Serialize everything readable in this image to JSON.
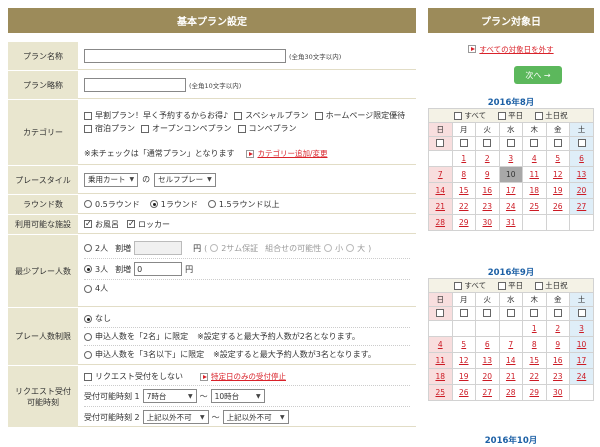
{
  "left_title": "基本プラン設定",
  "right_title": "プラン対象日",
  "plan_name": {
    "label": "プラン名称",
    "hint": "(全角30文字以内)"
  },
  "plan_short": {
    "label": "プラン略称",
    "hint": "(全角10文字以内)"
  },
  "category": {
    "label": "カテゴリー",
    "options": [
      "早割プラン！早く予約するからお得♪",
      "スペシャルプラン",
      "ホームページ限定優待",
      "宿泊プラン",
      "オープンコンペプラン",
      "コンペプラン"
    ],
    "note": "※未チェックは「通常プラン」となります",
    "link": "カテゴリー追加/変更"
  },
  "play_style": {
    "label": "プレースタイル",
    "select1": "乗用カート",
    "connector": "の",
    "select2": "セルフプレー"
  },
  "rounds": {
    "label": "ラウンド数",
    "options": [
      "0.5ラウンド",
      "1ラウンド",
      "1.5ラウンド以上"
    ],
    "selected": 1
  },
  "facilities": {
    "label": "利用可能な施設",
    "options": [
      "お風呂",
      "ロッカー"
    ]
  },
  "min_players": {
    "label": "最少プレー人数",
    "opt2": "2人",
    "surcharge": "割増",
    "yen": "円",
    "paren_open": "(",
    "guarantee": "2サム保証",
    "combo_label": "組合せの可能性",
    "small": "小",
    "large": "大",
    "paren_close": ")",
    "opt3": "3人",
    "opt3_value": "0",
    "opt4": "4人"
  },
  "max_players": {
    "label": "プレー人数制限",
    "none": "なし",
    "opt_a": "申込人数を「2名」に限定",
    "opt_a_note": "※設定すると最大予約人数が2名となります。",
    "opt_b": "申込人数を「3名以下」に限定",
    "opt_b_note": "※設定すると最大予約人数が3名となります。"
  },
  "request": {
    "label_line1": "リクエスト受付",
    "label_line2": "可能時刻",
    "checkbox": "リクエスト受付をしない",
    "link": "特定日のみの受付停止",
    "time1_label": "受付可能時刻 1",
    "time1_from": "7時台",
    "tilde": "～",
    "time1_to": "10時台",
    "time2_label": "受付可能時刻 2",
    "time2_from": "上記以外不可",
    "time2_to": "上記以外不可"
  },
  "reset_link": "すべての対象日を外す",
  "next_button": "次へ →",
  "calendar_options": [
    "すべて",
    "平日",
    "土日祝"
  ],
  "weekdays": [
    "日",
    "月",
    "火",
    "水",
    "木",
    "金",
    "土"
  ],
  "months": [
    {
      "title": "2016年8月",
      "weeks": [
        [
          "",
          "1",
          "2",
          "3",
          "4",
          "5",
          "6"
        ],
        [
          "7",
          "8",
          "9",
          "10",
          "11",
          "12",
          "13"
        ],
        [
          "14",
          "15",
          "16",
          "17",
          "18",
          "19",
          "20"
        ],
        [
          "21",
          "22",
          "23",
          "24",
          "25",
          "26",
          "27"
        ],
        [
          "28",
          "29",
          "30",
          "31",
          "",
          "",
          ""
        ]
      ]
    },
    {
      "title": "2016年9月",
      "weeks": [
        [
          "",
          "",
          "",
          "",
          "1",
          "2",
          "3"
        ],
        [
          "4",
          "5",
          "6",
          "7",
          "8",
          "9",
          "10"
        ],
        [
          "11",
          "12",
          "13",
          "14",
          "15",
          "16",
          "17"
        ],
        [
          "18",
          "19",
          "20",
          "21",
          "22",
          "23",
          "24"
        ],
        [
          "25",
          "26",
          "27",
          "28",
          "29",
          "30",
          ""
        ]
      ]
    },
    {
      "title": "2016年10月"
    }
  ],
  "today_cell": "10",
  "colors": {
    "banner": "#9c8b5a",
    "label_bg": "#e9e6cf",
    "link_red": "#d9222a",
    "month_blue": "#1b5fa5",
    "next_green": "#5cb85c"
  }
}
